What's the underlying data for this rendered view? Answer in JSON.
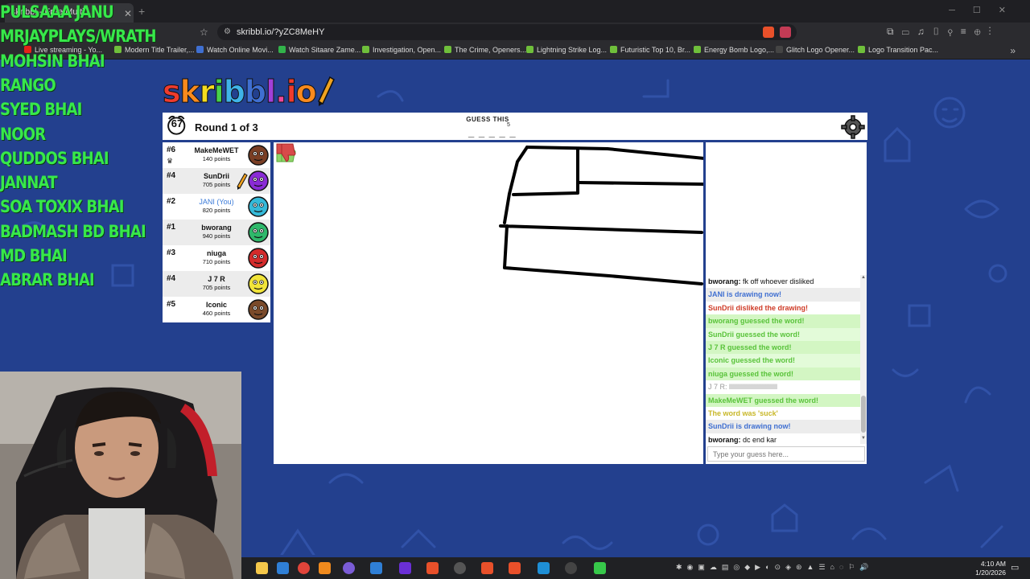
{
  "browser": {
    "tab_title": "skribbl - Free Multi...",
    "url": "skribbl.io/?yZC8MeHY",
    "bookmarks": [
      {
        "label": "Live streaming - Yo...",
        "color": "#e62117"
      },
      {
        "label": "Modern Title Trailer,...",
        "color": "#6fbf3b"
      },
      {
        "label": "Watch Online Movi...",
        "color": "#3f6fd1"
      },
      {
        "label": "Watch Sitaare Zame...",
        "color": "#32b34a"
      },
      {
        "label": "Investigation, Open...",
        "color": "#6fbf3b"
      },
      {
        "label": "The Crime, Openers...",
        "color": "#6fbf3b"
      },
      {
        "label": "Lightning Strike Log...",
        "color": "#6fbf3b"
      },
      {
        "label": "Futuristic Top 10, Br...",
        "color": "#6fbf3b"
      },
      {
        "label": "Energy Bomb Logo,...",
        "color": "#6fbf3b"
      },
      {
        "label": "Glitch Logo Opener...",
        "color": "#444444"
      },
      {
        "label": "Logo Transition Pac...",
        "color": "#6fbf3b"
      }
    ]
  },
  "overlay": {
    "viewer_names": [
      "PULSAAA JANU",
      "MRJAYPLAYS/WRATH",
      "MOHSIN BHAI",
      "RANGO",
      "SYED BHAI",
      "NOOR",
      "QUDDOS BHAI",
      "JANNAT",
      "SOA TOXIX BHAI",
      "BADMASH BD BHAI",
      "MD BHAI",
      "ABRAR BHAI"
    ]
  },
  "game": {
    "logo_text": "skribbl.io",
    "timer": "67",
    "round_text": "Round 1 of 3",
    "guess_label": "GUESS THIS",
    "word_length": "5",
    "word_hint": "_ _ _ _ _"
  },
  "players": [
    {
      "rank": "#6",
      "name": "MakeMeWET",
      "points": "140 points",
      "you": false,
      "avatar_color": "#7a3e24",
      "has_crown": true
    },
    {
      "rank": "#4",
      "name": "SunDrii",
      "points": "705 points",
      "you": false,
      "avatar_color": "#8a2bd6",
      "drawing": true
    },
    {
      "rank": "#2",
      "name": "JANI (You)",
      "points": "820 points",
      "you": true,
      "avatar_color": "#35b9d8"
    },
    {
      "rank": "#1",
      "name": "bworang",
      "points": "940 points",
      "you": false,
      "avatar_color": "#2fb86a"
    },
    {
      "rank": "#3",
      "name": "niuga",
      "points": "710 points",
      "you": false,
      "avatar_color": "#d42b2b"
    },
    {
      "rank": "#4",
      "name": "J 7 R",
      "points": "705 points",
      "you": false,
      "avatar_color": "#f1e43a"
    },
    {
      "rank": "#5",
      "name": "Iconic",
      "points": "460 points",
      "you": false,
      "avatar_color": "#7a4a2a"
    }
  ],
  "chat": {
    "messages": [
      {
        "author": "bworang",
        "text": "fk off whoever disliked",
        "style": "normal"
      },
      {
        "author": "",
        "text": "JANI is drawing now!",
        "style": "blue"
      },
      {
        "author": "",
        "text": "SunDrii disliked the drawing!",
        "style": "red"
      },
      {
        "author": "",
        "text": "bworang guessed the word!",
        "style": "green"
      },
      {
        "author": "",
        "text": "SunDrii guessed the word!",
        "style": "green"
      },
      {
        "author": "",
        "text": "J 7 R guessed the word!",
        "style": "green"
      },
      {
        "author": "",
        "text": "Iconic guessed the word!",
        "style": "green"
      },
      {
        "author": "",
        "text": "niuga guessed the word!",
        "style": "green"
      },
      {
        "author": "",
        "text": "J 7 R: llllllllllllllllllllllllllllll",
        "style": "grey"
      },
      {
        "author": "",
        "text": "MakeMeWET guessed the word!",
        "style": "green"
      },
      {
        "author": "",
        "text": "The word was 'suck'",
        "style": "yellow"
      },
      {
        "author": "",
        "text": "SunDrii is drawing now!",
        "style": "blue"
      },
      {
        "author": "bworang",
        "text": "dc end kar",
        "style": "normal"
      }
    ],
    "input_placeholder": "Type your guess here..."
  },
  "system": {
    "time": "4:10 AM",
    "date": "1/20/2026"
  }
}
